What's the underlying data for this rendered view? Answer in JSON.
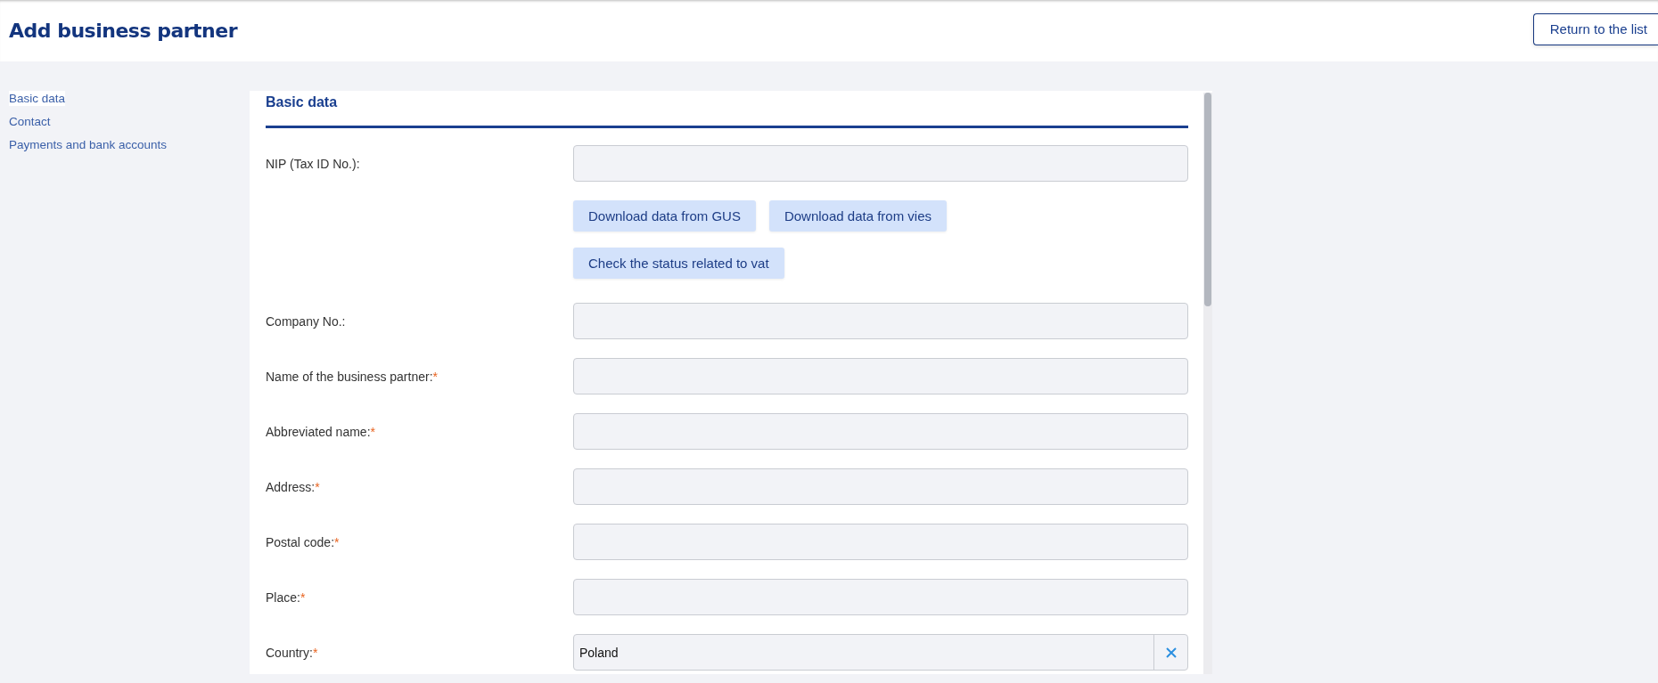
{
  "header": {
    "title": "Add business partner",
    "return_button": "Return to the list"
  },
  "sidebar": {
    "items": [
      {
        "label": "Basic data",
        "selected": true
      },
      {
        "label": "Contact",
        "selected": false
      },
      {
        "label": "Payments and bank accounts",
        "selected": false
      }
    ]
  },
  "section": {
    "title": "Basic data",
    "required_marker": "*",
    "rows": [
      {
        "kind": "text",
        "label": "NIP (Tax ID No.):",
        "required": false
      },
      {
        "kind": "buttons",
        "button_rows": [
          [
            "Download data from GUS",
            "Download data from vies"
          ],
          [
            "Check the status related to vat"
          ]
        ]
      },
      {
        "kind": "text",
        "label": "Company No.:",
        "required": false
      },
      {
        "kind": "text",
        "label": "Name of the business partner:",
        "required": true
      },
      {
        "kind": "text",
        "label": "Abbreviated name:",
        "required": true
      },
      {
        "kind": "text",
        "label": "Address:",
        "required": true
      },
      {
        "kind": "text",
        "label": "Postal code:",
        "required": true
      },
      {
        "kind": "text",
        "label": "Place:",
        "required": true
      },
      {
        "kind": "select",
        "label": "Country:",
        "required": true,
        "value": "Poland"
      }
    ]
  }
}
